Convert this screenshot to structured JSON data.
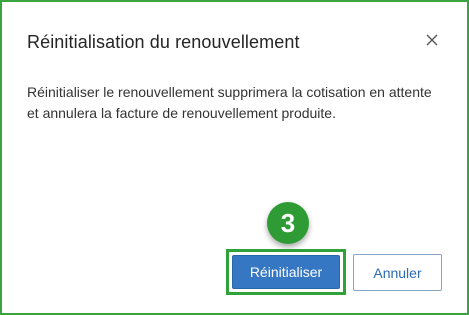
{
  "dialog": {
    "title": "Réinitialisation du renouvellement",
    "message": "Réinitialiser le renouvellement supprimera la cotisation en attente et annulera la facture de renouvellement produite.",
    "close_icon": "close-icon"
  },
  "annotation": {
    "step_number": "3"
  },
  "buttons": {
    "primary_label": "Réinitialiser",
    "secondary_label": "Annuler"
  },
  "colors": {
    "frame_border": "#3aa441",
    "primary_button": "#3577c2",
    "step_badge": "#2e9b35",
    "secondary_text": "#2b6cb5"
  }
}
